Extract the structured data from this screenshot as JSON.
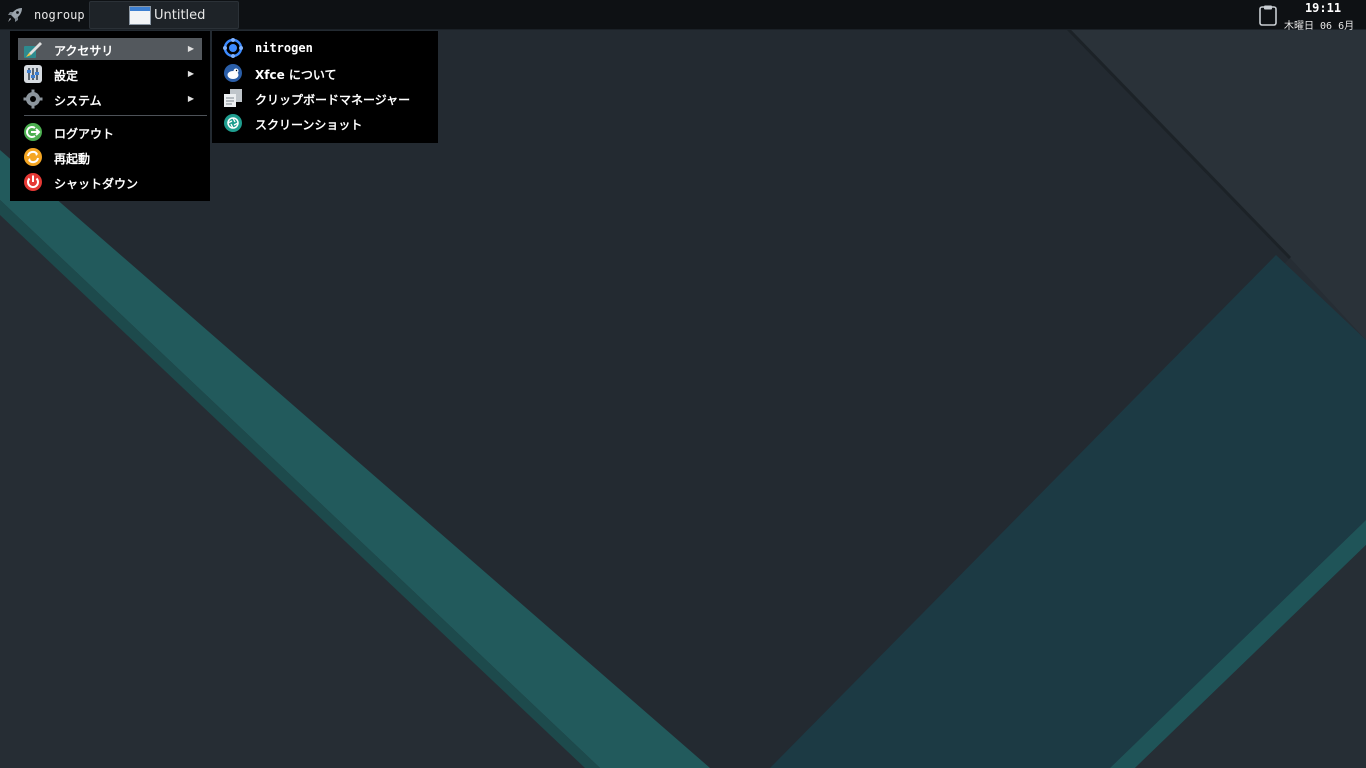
{
  "panel": {
    "launcher_label": "nogroup",
    "tasks": [
      {
        "title": "Untitled"
      }
    ],
    "clock": {
      "time": "19:11",
      "date": "木曜日 06 6月"
    }
  },
  "main_menu": {
    "items": [
      {
        "label": "アクセサリ",
        "icon": "accessories-icon",
        "submenu": true,
        "highlighted": true
      },
      {
        "label": "設定",
        "icon": "settings-icon",
        "submenu": true
      },
      {
        "label": "システム",
        "icon": "system-gear-icon",
        "submenu": true
      },
      {
        "label": "ログアウト",
        "icon": "logout-icon"
      },
      {
        "label": "再起動",
        "icon": "restart-icon"
      },
      {
        "label": "シャットダウン",
        "icon": "shutdown-icon"
      }
    ]
  },
  "sub_menu": {
    "items": [
      {
        "label": "nitrogen",
        "icon": "nitrogen-icon"
      },
      {
        "label": "Xfce について",
        "icon": "xfce-icon"
      },
      {
        "label": "クリップボードマネージャー",
        "icon": "clipboard-manager-icon"
      },
      {
        "label": "スクリーンショット",
        "icon": "screenshot-icon"
      }
    ]
  },
  "colors": {
    "panel_bg": "#0e1114",
    "menu_bg": "#000000",
    "highlight": "#53585d",
    "wallpaper_dark": "#262e35",
    "wallpaper_teal": "#225a5c",
    "logout_green": "#4caf50",
    "restart_orange": "#f5a623",
    "shutdown_red": "#e53935"
  }
}
